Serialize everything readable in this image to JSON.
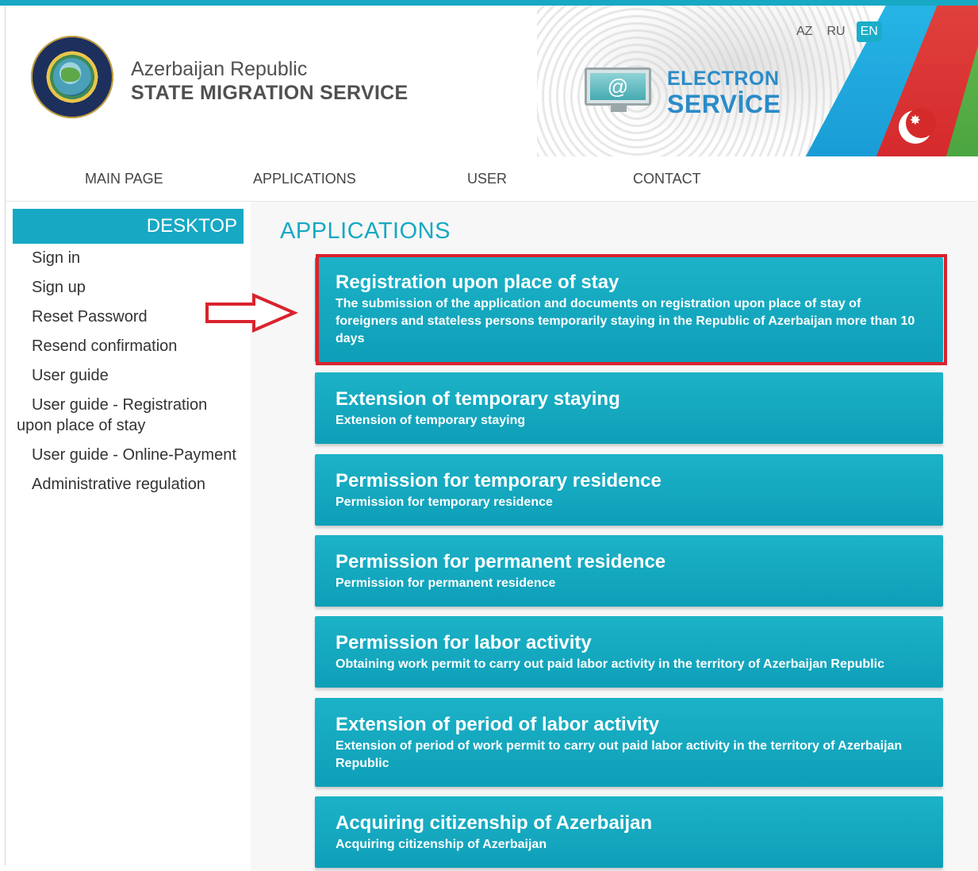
{
  "header": {
    "subtitle": "Azerbaijan Republic",
    "title": "STATE MIGRATION SERVICE",
    "electron_line1": "ELECTRON",
    "electron_line2": "SERVİCE",
    "monitor_symbol": "@",
    "star_symbol": "✸",
    "languages": [
      "AZ",
      "RU",
      "EN"
    ],
    "active_language": "EN"
  },
  "nav": {
    "items": [
      "MAIN PAGE",
      "APPLICATIONS",
      "USER",
      "CONTACT"
    ]
  },
  "sidebar": {
    "header": "DESKTOP",
    "items": [
      "Sign in",
      "Sign up",
      "Reset Password",
      "Resend confirmation",
      "User guide",
      "User guide - Registration upon place of stay",
      "User guide - Online-Payment",
      "Administrative regulation"
    ]
  },
  "main": {
    "section_title": "APPLICATIONS",
    "cards": [
      {
        "title": "Registration upon place of stay",
        "desc": "The submission of the application and documents on registration upon place of stay of foreigners and stateless persons temporarily staying in the Republic of Azerbaijan more than 10 days"
      },
      {
        "title": "Extension of temporary staying",
        "desc": "Extension of temporary staying"
      },
      {
        "title": "Permission for temporary residence",
        "desc": "Permission for temporary residence"
      },
      {
        "title": "Permission for permanent residence",
        "desc": "Permission for permanent residence"
      },
      {
        "title": "Permission for labor activity",
        "desc": "Obtaining work permit to carry out paid labor activity in the territory of Azerbaijan Republic"
      },
      {
        "title": "Extension of period of labor activity",
        "desc": "Extension of period of work permit to carry out paid labor activity in the territory of Azerbaijan Republic"
      },
      {
        "title": "Acquiring citizenship of Azerbaijan",
        "desc": "Acquiring citizenship of Azerbaijan"
      }
    ]
  },
  "colors": {
    "accent": "#17a8c4",
    "highlight": "#d9232d",
    "brand_text": "#2a8bc9"
  }
}
